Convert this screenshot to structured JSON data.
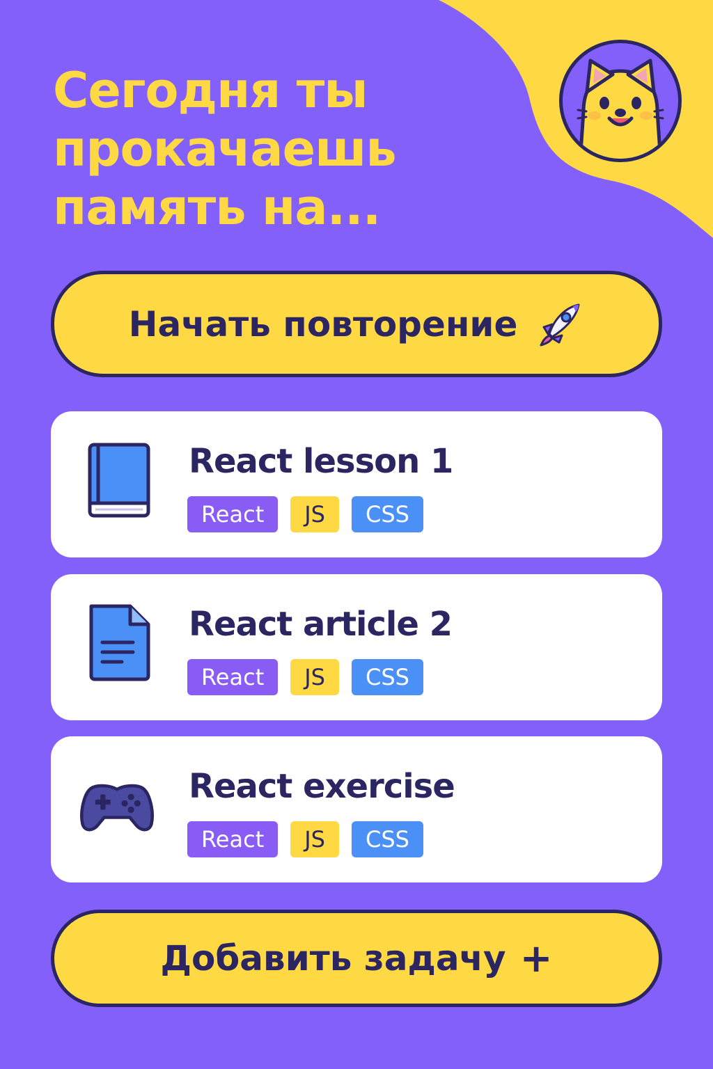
{
  "header": {
    "title": "Сегодня ты прокачаешь память на..."
  },
  "actions": {
    "start_label": "Начать повторение",
    "add_label": "Добавить задачу",
    "add_symbol": "+"
  },
  "tasks": [
    {
      "title": "React lesson 1",
      "icon": "book-icon",
      "tags": [
        "React",
        "JS",
        "CSS"
      ]
    },
    {
      "title": "React article 2",
      "icon": "document-icon",
      "tags": [
        "React",
        "JS",
        "CSS"
      ]
    },
    {
      "title": "React exercise",
      "icon": "gamepad-icon",
      "tags": [
        "React",
        "JS",
        "CSS"
      ]
    }
  ],
  "icons": {
    "avatar": "cat-mascot-icon",
    "start": "rocket-icon"
  },
  "colors": {
    "background": "#8460fb",
    "accent_yellow": "#ffd944",
    "text_dark": "#2b2662",
    "card": "#ffffff",
    "tag_react": "#8a5cf6",
    "tag_js": "#ffd944",
    "tag_css": "#4b90f7"
  }
}
